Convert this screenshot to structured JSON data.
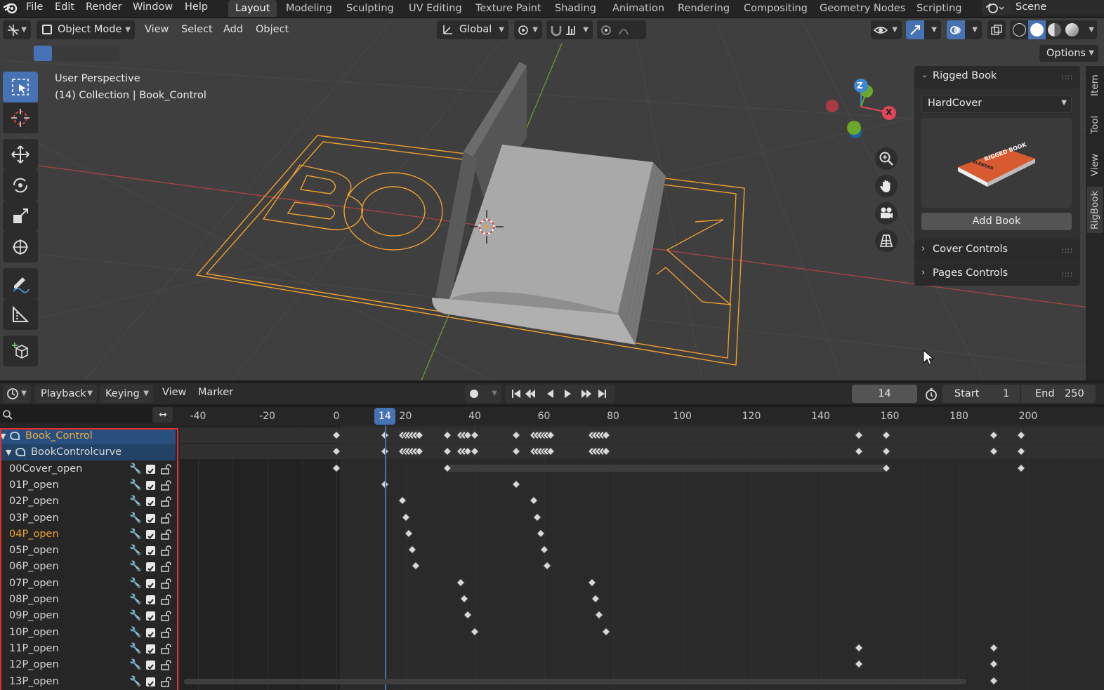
{
  "menu": {
    "items": [
      "File",
      "Edit",
      "Render",
      "Window",
      "Help"
    ]
  },
  "workspaces": [
    "Layout",
    "Modeling",
    "Sculpting",
    "UV Editing",
    "Texture Paint",
    "Shading",
    "Animation",
    "Rendering",
    "Compositing",
    "Geometry Nodes",
    "Scripting"
  ],
  "scene_label": "Scene",
  "viewport_header": {
    "mode": "Object Mode",
    "menus": [
      "View",
      "Select",
      "Add",
      "Object"
    ],
    "orientation": "Global",
    "options": "Options"
  },
  "viewport": {
    "perspective": "User Perspective",
    "collection_info": "(14) Collection | Book_Control",
    "floor_text": "BOOK",
    "gizmo": {
      "z": "Z",
      "x": "X"
    }
  },
  "npanel": {
    "title": "Rigged Book",
    "preset": "HardCover",
    "thumb_title": "RIGGED BOOK",
    "thumb_sub": "BLENDER",
    "add_button": "Add Book",
    "sections": [
      "Cover Controls",
      "Pages Controls"
    ]
  },
  "side_tabs": [
    "Item",
    "Tool",
    "View",
    "RigBook"
  ],
  "timeline": {
    "menus": [
      "Playback",
      "Keying",
      "View",
      "Marker"
    ],
    "current_frame": "14",
    "start_label": "Start",
    "start_value": "1",
    "end_label": "End",
    "end_value": "250",
    "ruler_labels": [
      "-40",
      "-20",
      "0",
      "14",
      "20",
      "40",
      "60",
      "80",
      "100",
      "120",
      "140",
      "160",
      "180",
      "200"
    ],
    "channels": [
      {
        "name": "Book_Control",
        "type": "object",
        "highlight": "selected"
      },
      {
        "name": "BookControlcurve",
        "type": "data",
        "highlight": "selected2"
      },
      {
        "name": "00Cover_open"
      },
      {
        "name": "01P_open"
      },
      {
        "name": "02P_open"
      },
      {
        "name": "03P_open"
      },
      {
        "name": "04P_open",
        "active": true
      },
      {
        "name": "05P_open"
      },
      {
        "name": "06P_open"
      },
      {
        "name": "07P_open"
      },
      {
        "name": "08P_open"
      },
      {
        "name": "09P_open"
      },
      {
        "name": "10P_open"
      },
      {
        "name": "11P_open"
      },
      {
        "name": "12P_open"
      },
      {
        "name": "13P_open"
      }
    ],
    "keyframes": [
      [
        0,
        14,
        19,
        20,
        21,
        22,
        23,
        24,
        32,
        36,
        37,
        38,
        40,
        52,
        57,
        58,
        59,
        60,
        61,
        62,
        74,
        75,
        76,
        77,
        78,
        151,
        159,
        190,
        198
      ],
      [
        0,
        14,
        19,
        20,
        21,
        22,
        23,
        24,
        32,
        36,
        37,
        38,
        40,
        52,
        57,
        58,
        59,
        60,
        61,
        62,
        74,
        75,
        76,
        77,
        78,
        151,
        159,
        190,
        198
      ],
      [
        0,
        32,
        159,
        198
      ],
      [
        14,
        52
      ],
      [
        19,
        57
      ],
      [
        20,
        58
      ],
      [
        21,
        59
      ],
      [
        22,
        60
      ],
      [
        23,
        61
      ],
      [
        36,
        74
      ],
      [
        37,
        75
      ],
      [
        38,
        76
      ],
      [
        40,
        78
      ],
      [
        151,
        190
      ],
      [
        151,
        190
      ],
      [
        190
      ]
    ],
    "hold_bar": {
      "row": 2,
      "from": 32,
      "to": 159
    }
  },
  "colors": {
    "accent_blue": "#4772b3",
    "selection_orange": "#f0a030",
    "axis_red": "#c84040",
    "axis_green": "#6a9a30",
    "gizmo_x": "#e0455a",
    "gizmo_y": "#6aa82a",
    "gizmo_z": "#3f86d6",
    "channel_outline": "#e03030"
  }
}
